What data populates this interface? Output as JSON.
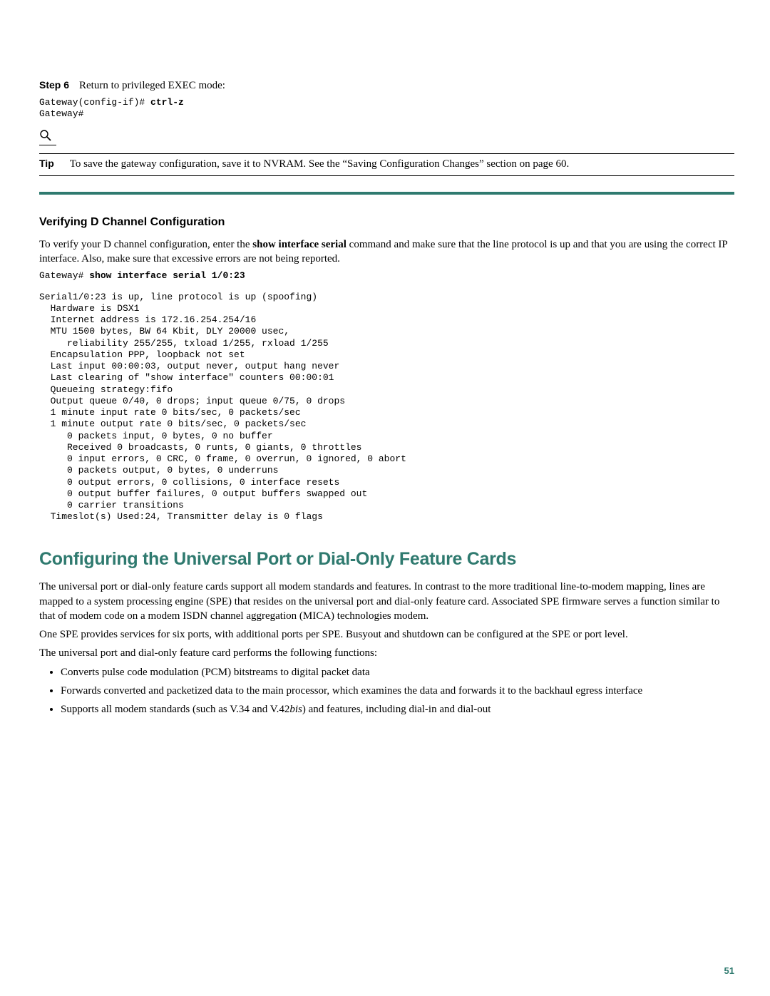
{
  "step": {
    "label": "Step 6",
    "text": "Return to privileged EXEC mode:",
    "code_prefix": "Gateway(config-if)# ",
    "code_cmd": "ctrl-z",
    "code_line2": "Gateway#"
  },
  "tip": {
    "label": "Tip",
    "text": "To save the gateway configuration, save it to NVRAM. See the “Saving Configuration Changes” section on page 60."
  },
  "verify": {
    "heading": "Verifying D Channel Configuration",
    "intro_before_bold": "To verify your D channel configuration, enter the ",
    "intro_bold": "show interface serial",
    "intro_after_bold": " command and make sure that the line protocol is up and that you are using the correct IP interface. Also, make sure that excessive errors are not being reported.",
    "cmd_prefix": "Gateway# ",
    "cmd_bold": "show interface serial 1/0:23",
    "output": "Serial1/0:23 is up, line protocol is up (spoofing)\n  Hardware is DSX1\n  Internet address is 172.16.254.254/16\n  MTU 1500 bytes, BW 64 Kbit, DLY 20000 usec,\n     reliability 255/255, txload 1/255, rxload 1/255\n  Encapsulation PPP, loopback not set\n  Last input 00:00:03, output never, output hang never\n  Last clearing of \"show interface\" counters 00:00:01\n  Queueing strategy:fifo\n  Output queue 0/40, 0 drops; input queue 0/75, 0 drops\n  1 minute input rate 0 bits/sec, 0 packets/sec\n  1 minute output rate 0 bits/sec, 0 packets/sec\n     0 packets input, 0 bytes, 0 no buffer\n     Received 0 broadcasts, 0 runts, 0 giants, 0 throttles\n     0 input errors, 0 CRC, 0 frame, 0 overrun, 0 ignored, 0 abort\n     0 packets output, 0 bytes, 0 underruns\n     0 output errors, 0 collisions, 0 interface resets\n     0 output buffer failures, 0 output buffers swapped out\n     0 carrier transitions\n  Timeslot(s) Used:24, Transmitter delay is 0 flags"
  },
  "section": {
    "heading": "Configuring the Universal Port or Dial-Only Feature Cards",
    "p1": "The universal port or dial-only feature cards support all modem standards and features. In contrast to the more traditional line-to-modem mapping, lines are mapped to a system processing engine (SPE) that resides on the universal port and dial-only feature card. Associated SPE firmware serves a function similar to that of modem code on a modem ISDN channel aggregation (MICA) technologies modem.",
    "p2": "One SPE provides services for six ports, with additional ports per SPE. Busyout and shutdown can be configured at the SPE or port level.",
    "p3": "The universal port and dial-only feature card performs the following functions:",
    "bullets": [
      "Converts pulse code modulation (PCM) bitstreams to digital packet data",
      "Forwards converted and packetized data to the main processor, which examines the data and forwards it to the backhaul egress interface"
    ],
    "bullet3_before": "Supports all modem standards (such as V.34 and V.42",
    "bullet3_ital": "bis",
    "bullet3_after": ") and features, including dial-in and dial-out"
  },
  "pagenum": "51"
}
